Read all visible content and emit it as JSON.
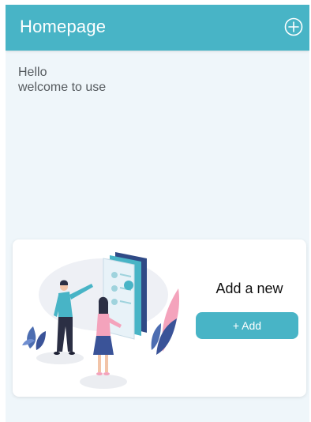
{
  "header": {
    "title": "Homepage",
    "add_icon": "plus-circle-icon"
  },
  "greeting": {
    "line1": "Hello",
    "line2": "welcome to use"
  },
  "card": {
    "title": "Add a new",
    "button_label": "+ Add",
    "illustration": "people-with-documents-illustration"
  },
  "colors": {
    "accent": "#48b4c6",
    "background": "#eff6fa",
    "card": "#ffffff"
  }
}
